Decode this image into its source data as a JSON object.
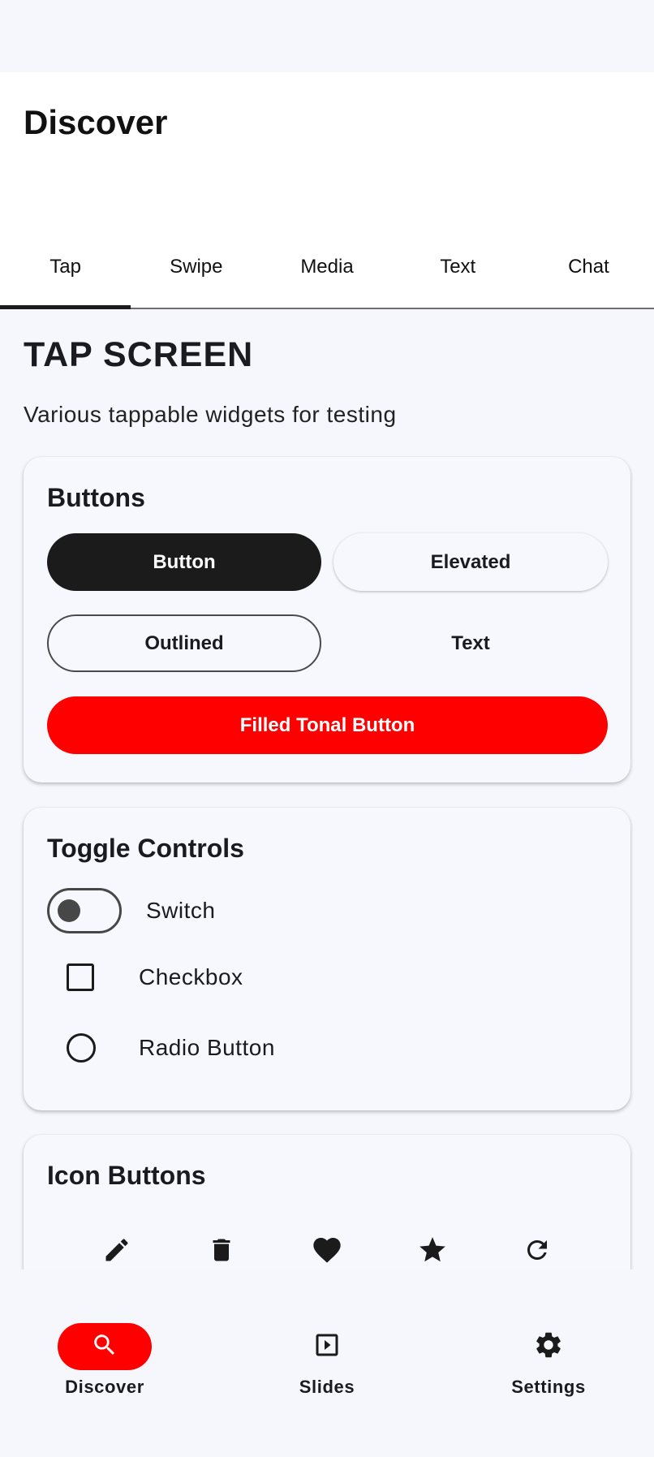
{
  "app": {
    "title": "Discover"
  },
  "tabs": [
    {
      "label": "Tap",
      "active": true
    },
    {
      "label": "Swipe",
      "active": false
    },
    {
      "label": "Media",
      "active": false
    },
    {
      "label": "Text",
      "active": false
    },
    {
      "label": "Chat",
      "active": false
    }
  ],
  "screen": {
    "title": "TAP SCREEN",
    "subtitle": "Various tappable widgets for testing"
  },
  "buttons_card": {
    "title": "Buttons",
    "button_label": "Button",
    "elevated_label": "Elevated",
    "outlined_label": "Outlined",
    "text_label": "Text",
    "tonal_label": "Filled Tonal Button"
  },
  "toggle_card": {
    "title": "Toggle Controls",
    "switch_label": "Switch",
    "switch_on": false,
    "checkbox_label": "Checkbox",
    "checkbox_checked": false,
    "radio_label": "Radio Button",
    "radio_selected": false
  },
  "icon_card": {
    "title": "Icon Buttons",
    "icons": [
      "edit-icon",
      "delete-icon",
      "favorite-icon",
      "star-icon",
      "refresh-icon"
    ]
  },
  "bottom_nav": {
    "items": [
      {
        "label": "Discover",
        "icon": "search-icon",
        "active": true
      },
      {
        "label": "Slides",
        "icon": "slideshow-icon",
        "active": false
      },
      {
        "label": "Settings",
        "icon": "gear-icon",
        "active": false
      }
    ]
  },
  "colors": {
    "accent": "#ff0000",
    "primary_dark": "#1b1b1b",
    "surface": "#f7f8fd",
    "background": "#f6f7fc"
  }
}
